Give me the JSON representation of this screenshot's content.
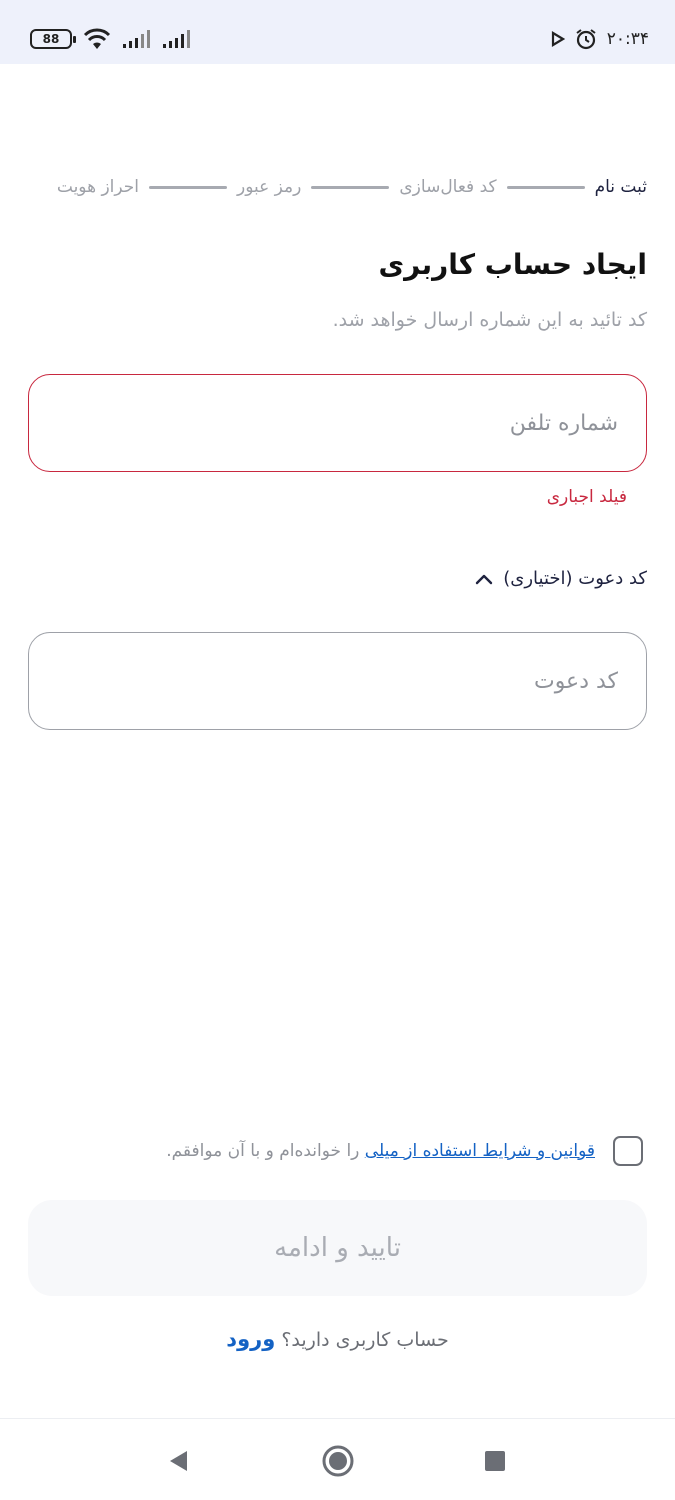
{
  "status_bar": {
    "time": "۲۰:۳۴",
    "battery": "88"
  },
  "stepper": {
    "steps": [
      "ثبت نام",
      "کد فعال‌سازی",
      "رمز عبور",
      "احراز هویت"
    ]
  },
  "header": {
    "title": "ایجاد حساب کاربری",
    "subtitle": "کد تائید به این شماره ارسال خواهد شد."
  },
  "phone_field": {
    "placeholder": "شماره تلفن",
    "value": "",
    "error": "فیلد اجباری"
  },
  "invite": {
    "toggle_label": "کد دعوت (اختیاری)",
    "placeholder": "کد دعوت",
    "value": ""
  },
  "terms": {
    "link_text": "قوانین و شرایط استفاده از میلی",
    "suffix_text": " را خوانده‌ام و با آن موافقم.",
    "checked": false
  },
  "primary_button": {
    "label": "تایید و ادامه"
  },
  "login": {
    "prompt": "حساب کاربری دارید؟ ",
    "link": "ورود"
  },
  "colors": {
    "error": "#c8283f",
    "link": "#1462c4",
    "status_bar_bg": "#eef1fb"
  }
}
